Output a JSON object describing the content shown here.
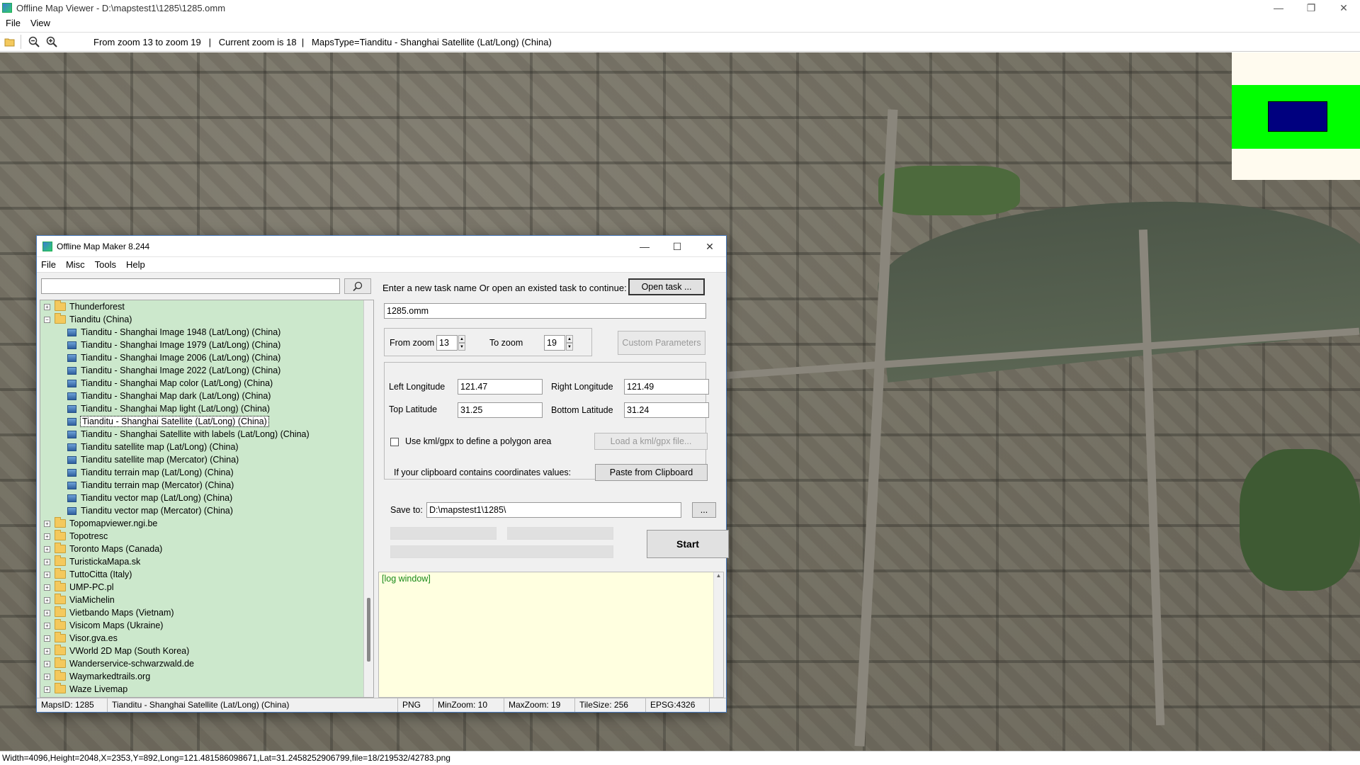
{
  "window": {
    "title": "Offline Map Viewer - D:\\mapstest1\\1285\\1285.omm",
    "controls": [
      "—",
      "❐",
      "✕"
    ]
  },
  "menu": [
    "File",
    "View"
  ],
  "toolbar": {
    "status": "From zoom 13 to zoom 19   |   Current zoom is 18  |   MapsType=Tianditu - Shanghai Satellite (Lat/Long) (China)"
  },
  "statusbar": "Width=4096,Height=2048,X=2353,Y=892,Long=121.481586098671,Lat=31.2458252906799,file=18/219532/42783.png",
  "colors": {
    "overview_green": "#00ff00",
    "overview_blue": "#00007f",
    "tree_bg": "#cce8cc",
    "log_bg": "#ffffe0"
  },
  "dialog": {
    "title": "Offline Map Maker 8.244",
    "controls": [
      "—",
      "☐",
      "✕"
    ],
    "menu": [
      "File",
      "Misc",
      "Tools",
      "Help"
    ],
    "search": {
      "value": "",
      "placeholder": ""
    },
    "tree": {
      "nodes_before": [
        {
          "label": "Thunderforest",
          "expanded": false
        }
      ],
      "expanded_node": "Tianditu (China)",
      "children": [
        "Tianditu - Shanghai Image 1948 (Lat/Long) (China)",
        "Tianditu - Shanghai Image 1979 (Lat/Long) (China)",
        "Tianditu - Shanghai Image 2006 (Lat/Long) (China)",
        "Tianditu - Shanghai Image 2022 (Lat/Long) (China)",
        "Tianditu - Shanghai Map color (Lat/Long) (China)",
        "Tianditu - Shanghai Map dark (Lat/Long) (China)",
        "Tianditu - Shanghai Map light (Lat/Long) (China)",
        "Tianditu - Shanghai Satellite (Lat/Long) (China)",
        "Tianditu - Shanghai Satellite with labels (Lat/Long) (China)",
        "Tianditu satellite map (Lat/Long) (China)",
        "Tianditu satellite map (Mercator) (China)",
        "Tianditu terrain map (Lat/Long) (China)",
        "Tianditu terrain map (Mercator) (China)",
        "Tianditu vector map (Lat/Long) (China)",
        "Tianditu vector map (Mercator) (China)"
      ],
      "selected_child": "Tianditu - Shanghai Satellite (Lat/Long) (China)",
      "nodes_after": [
        "Topomapviewer.ngi.be",
        "Topotresc",
        "Toronto Maps (Canada)",
        "TuristickaMapa.sk",
        "TuttoCitta (Italy)",
        "UMP-PC.pl",
        "ViaMichelin",
        "Vietbando Maps (Vietnam)",
        "Visicom Maps (Ukraine)",
        "Visor.gva.es",
        "VWorld 2D Map (South Korea)",
        "Wanderservice-schwarzwald.de",
        "Waymarkedtrails.org",
        "Waze Livemap"
      ]
    },
    "task_label": "Enter a new task name Or open an existed task to continue:",
    "open_task_button": "Open task ...",
    "task_name": "1285.omm",
    "from_zoom_label": "From zoom",
    "from_zoom": "13",
    "to_zoom_label": "To zoom",
    "to_zoom": "19",
    "custom_params_button": "Custom Parameters",
    "left_lon_label": "Left Longitude",
    "left_lon": "121.47",
    "right_lon_label": "Right Longitude",
    "right_lon": "121.49",
    "top_lat_label": "Top Latitude",
    "top_lat": "31.25",
    "bottom_lat_label": "Bottom Latitude",
    "bottom_lat": "31.24",
    "kml_checkbox_label": "Use kml/gpx to define a polygon area",
    "load_kml_button": "Load a kml/gpx file...",
    "clipboard_label": "If your clipboard contains coordinates values:",
    "paste_button": "Paste from Clipboard",
    "save_to_label": "Save to:",
    "save_to": "D:\\mapstest1\\1285\\",
    "browse_button": "...",
    "start_button": "Start",
    "log_text": "[log window]",
    "status": {
      "maps_id": "MapsID: 1285",
      "map_name": "Tianditu - Shanghai Satellite (Lat/Long) (China)",
      "format": "PNG",
      "min_zoom": "MinZoom: 10",
      "max_zoom": "MaxZoom: 19",
      "tile_size": "TileSize: 256",
      "epsg": "EPSG:4326"
    }
  }
}
